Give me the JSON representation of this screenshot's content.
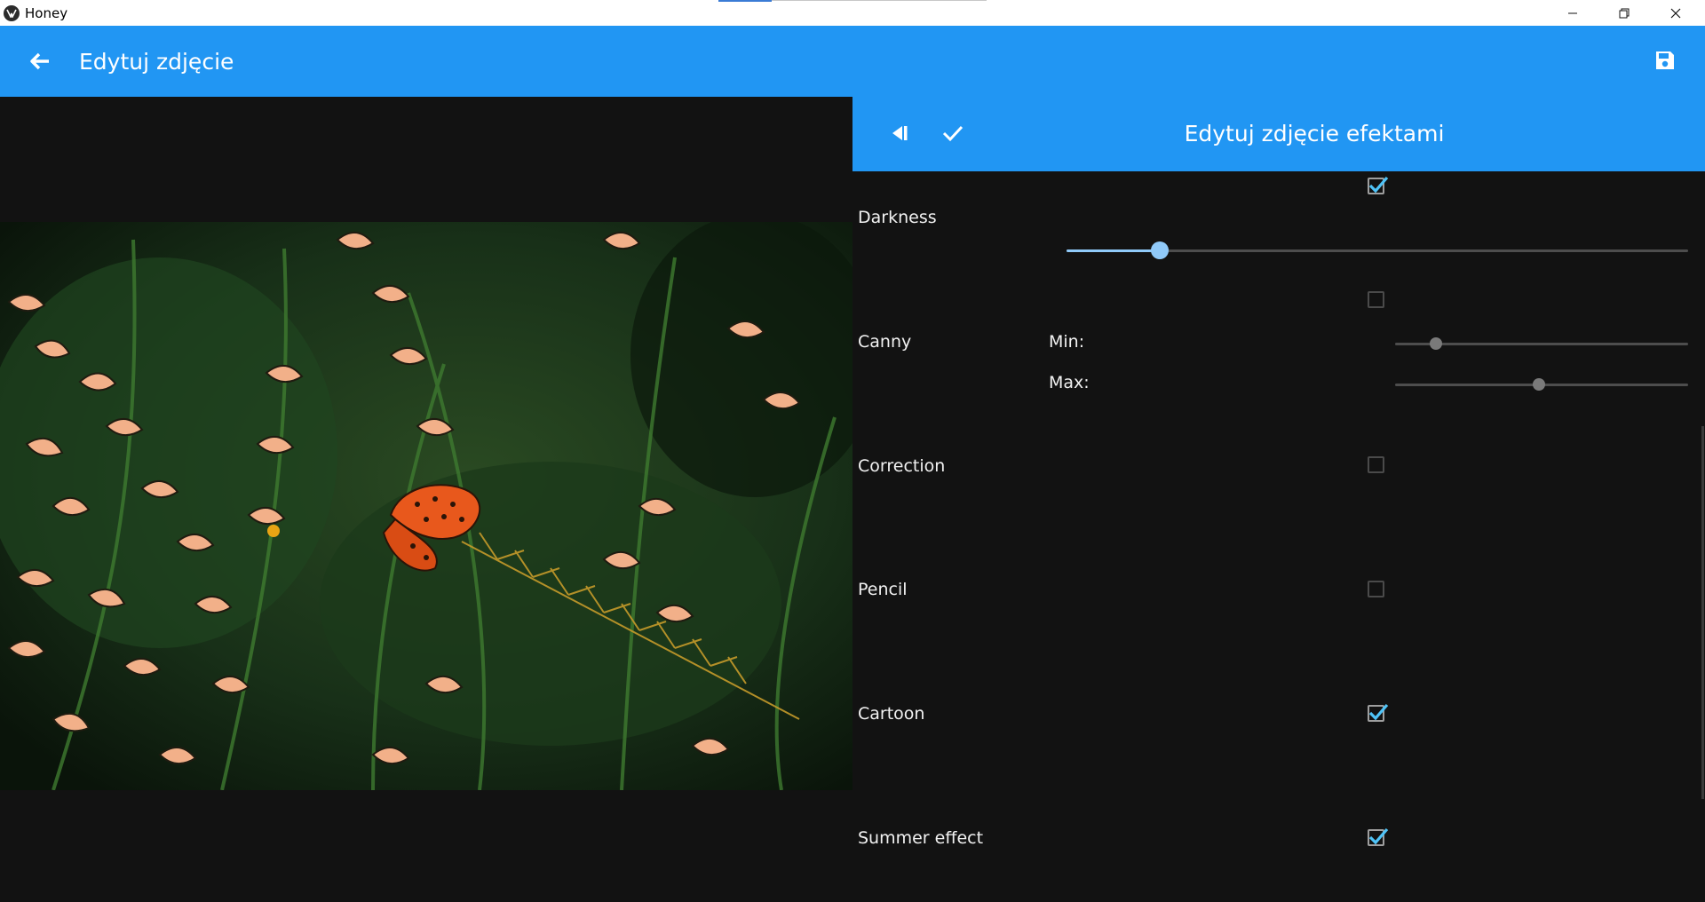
{
  "window": {
    "title": "Honey",
    "minimize_icon": "minimize-icon",
    "maximize_icon": "restore-icon",
    "close_icon": "close-icon"
  },
  "appbar": {
    "title": "Edytuj zdjęcie",
    "back_icon": "arrow-left-icon",
    "save_icon": "floppy-disk-icon",
    "color": "#2196f3"
  },
  "preview": {
    "image_alt": "Butterfly on wild grass (cartoon + summer effect)"
  },
  "panel": {
    "title": "Edytuj zdjęcie efektami",
    "collapse_icon": "collapse-panel-icon",
    "apply_icon": "check-icon",
    "effects": [
      {
        "name": "Darkness",
        "enabled": true,
        "level": 0.15
      },
      {
        "name": "Canny",
        "enabled": false,
        "min_label": "Min:",
        "min_value": 0.14,
        "max_label": "Max:",
        "max_value": 0.49
      },
      {
        "name": "Correction",
        "enabled": false
      },
      {
        "name": "Pencil",
        "enabled": false
      },
      {
        "name": "Cartoon",
        "enabled": true
      },
      {
        "name": "Summer effect",
        "enabled": true
      }
    ]
  },
  "colors": {
    "accent": "#2196f3",
    "slider_active": "#90caf9",
    "check": "#4fc3f7",
    "background": "#121212"
  }
}
